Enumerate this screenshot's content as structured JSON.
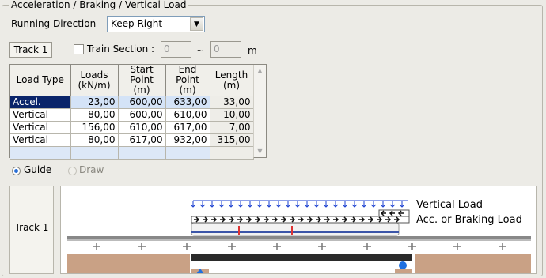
{
  "group_title": "Acceleration / Braking / Vertical Load",
  "running_direction": {
    "label": "Running Direction -",
    "value": "Keep Right",
    "arrow_icon": "chevron-down-icon"
  },
  "track": {
    "name": "Track 1"
  },
  "train_section": {
    "label": "Train Section :",
    "from": "0",
    "separator": "~",
    "to": "0",
    "unit": "m",
    "checked": false
  },
  "table": {
    "headers": [
      [
        "Load Type",
        ""
      ],
      [
        "Loads",
        "(kN/m)"
      ],
      [
        "Start",
        "Point (m)"
      ],
      [
        "End",
        "Point (m)"
      ],
      [
        "Length",
        "(m)"
      ]
    ],
    "rows": [
      [
        "Accel.",
        "23,00",
        "600,00",
        "633,00",
        "33,00"
      ],
      [
        "Vertical",
        "80,00",
        "600,00",
        "610,00",
        "10,00"
      ],
      [
        "Vertical",
        "156,00",
        "610,00",
        "617,00",
        "7,00"
      ],
      [
        "Vertical",
        "80,00",
        "617,00",
        "932,00",
        "315,00"
      ]
    ]
  },
  "view_mode": {
    "guide_label": "Guide",
    "draw_label": "Draw",
    "selected": "Guide"
  },
  "diagram": {
    "track_label": "Track 1",
    "vertical_load_label": "Vertical Load",
    "accel_label": "Acc. or Braking Load",
    "colors": {
      "vertical_arrow": "#1a3fd0",
      "ground": "#c9a185",
      "pin_support": "#1e6fe0",
      "roller_support": "#1e6fe0"
    }
  }
}
